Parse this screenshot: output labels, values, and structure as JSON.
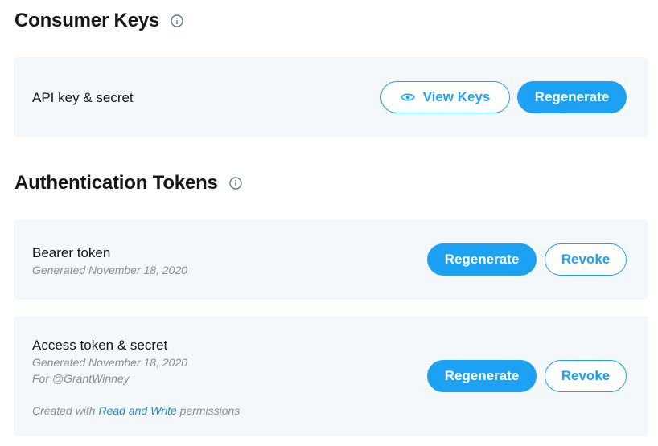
{
  "consumer_keys": {
    "title": "Consumer Keys",
    "info_icon": "info-icon",
    "row": {
      "label": "API key & secret",
      "view_keys_label": "View Keys",
      "view_keys_icon": "eye-icon",
      "regenerate_label": "Regenerate"
    }
  },
  "auth_tokens": {
    "title": "Authentication Tokens",
    "info_icon": "info-icon",
    "bearer": {
      "label": "Bearer token",
      "generated": "Generated November 18, 2020",
      "regenerate_label": "Regenerate",
      "revoke_label": "Revoke"
    },
    "access": {
      "label": "Access token & secret",
      "generated": "Generated November 18, 2020",
      "for_user": "For @GrantWinney",
      "permissions_prefix": "Created with",
      "permissions_link": "Read and Write",
      "permissions_suffix": "permissions",
      "regenerate_label": "Regenerate",
      "revoke_label": "Revoke"
    }
  },
  "colors": {
    "accent": "#1da1f2",
    "card_bg": "#f5f8fa",
    "muted_text": "#8a8d91",
    "link": "#1d8ad6"
  }
}
